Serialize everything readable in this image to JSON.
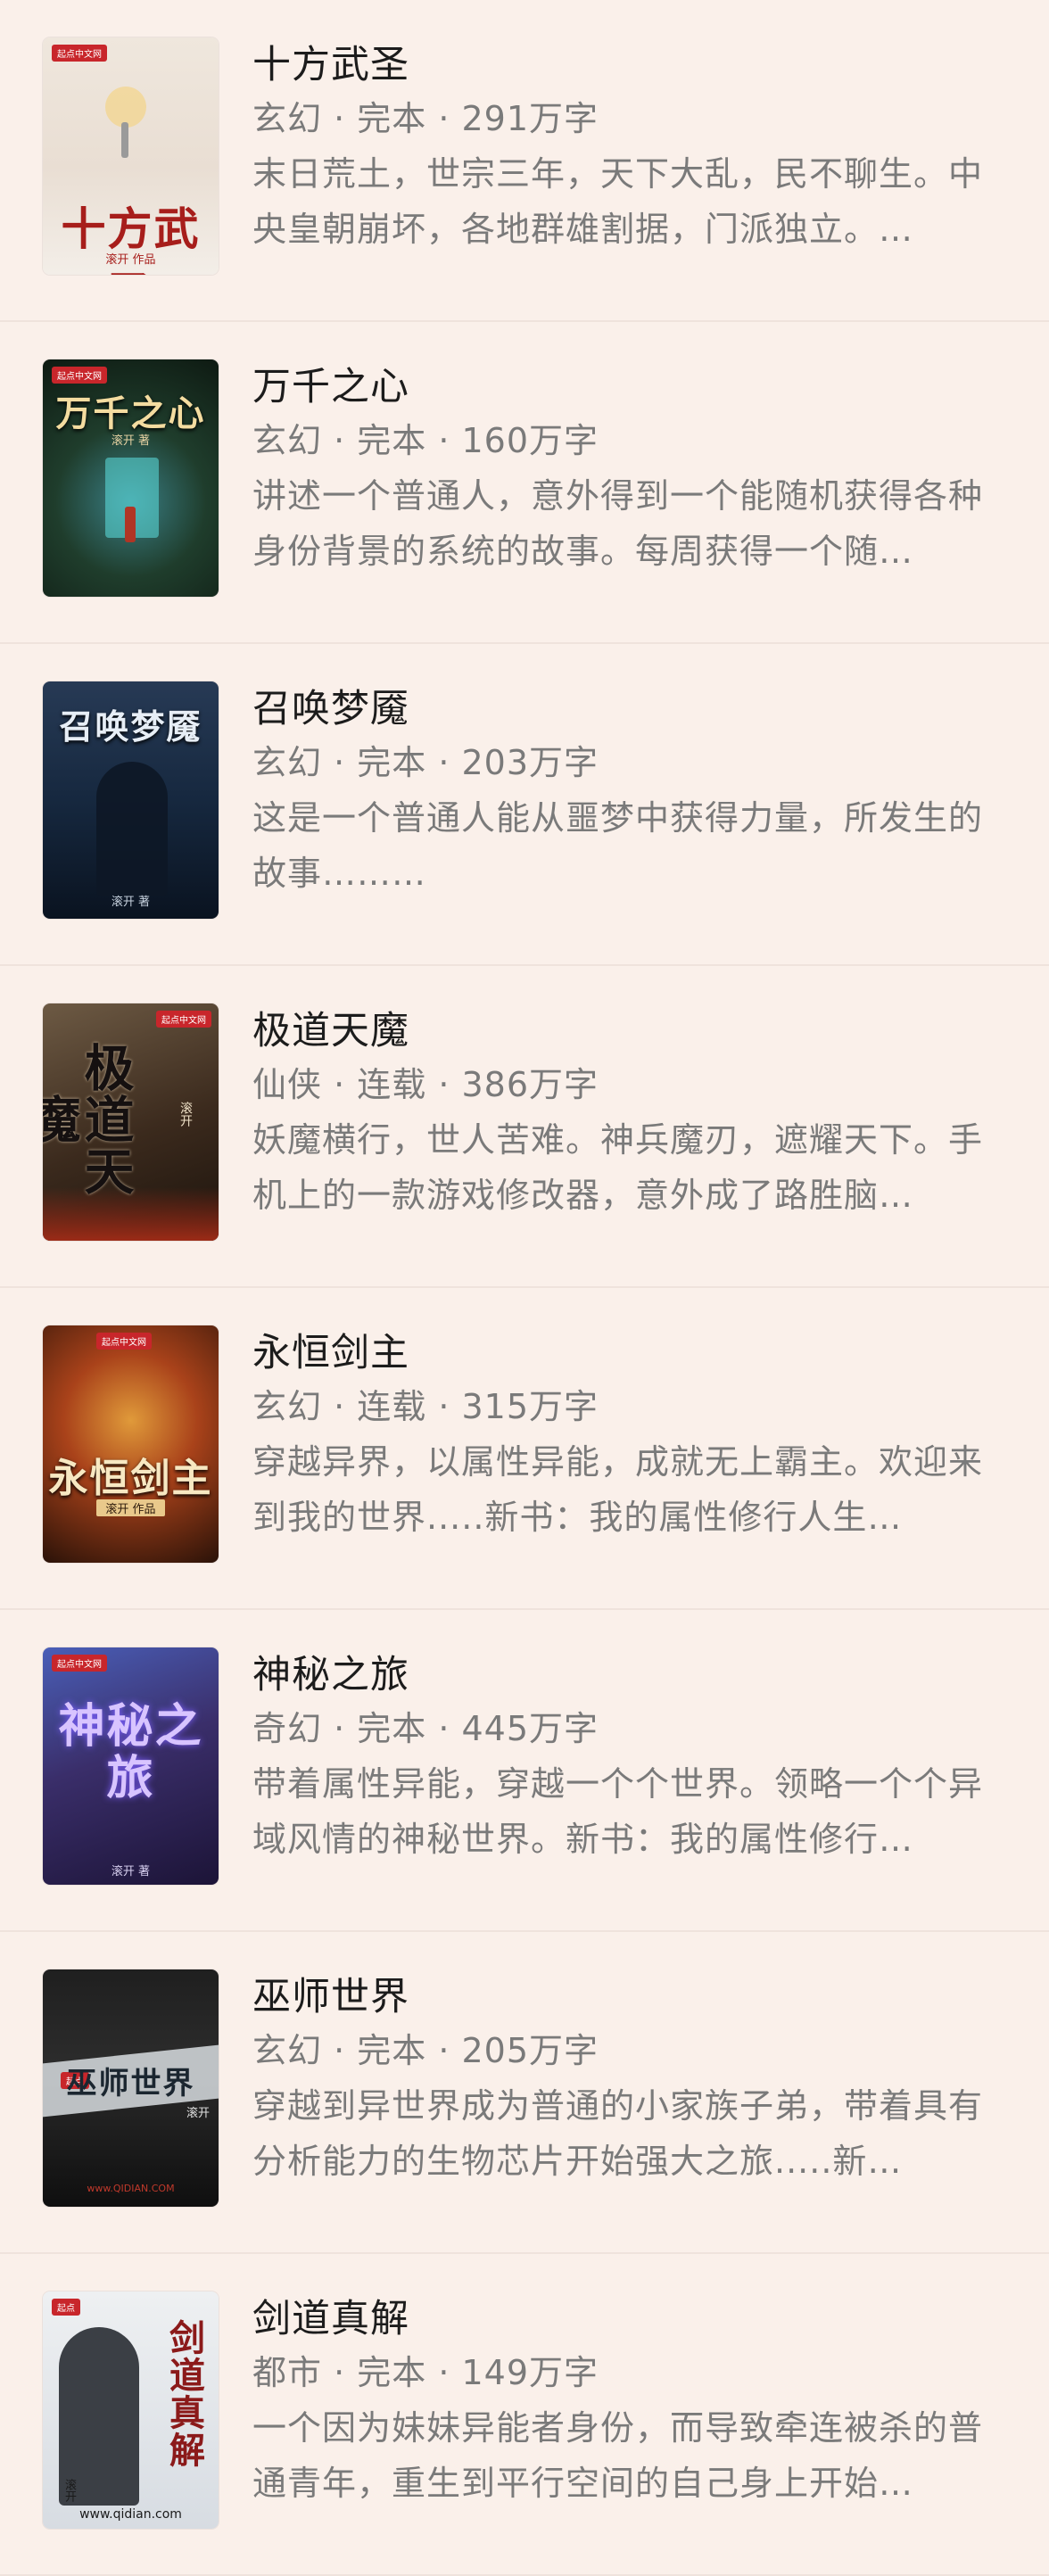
{
  "books": [
    {
      "title": "十方武圣",
      "meta": "玄幻 · 完本 · 291万字",
      "desc": "末日荒土，世宗三年，天下大乱，民不聊生。中央皇朝崩坏，各地群雄割据，门派独立。…",
      "cover": {
        "title": "十方武圣",
        "author": "滚开 作品",
        "badge": "起点中文网"
      }
    },
    {
      "title": "万千之心",
      "meta": "玄幻 · 完本 · 160万字",
      "desc": "讲述一个普通人，意外得到一个能随机获得各种身份背景的系统的故事。每周获得一个随…",
      "cover": {
        "title": "万千之心",
        "author": "滚开 著",
        "badge": "起点中文网"
      }
    },
    {
      "title": "召唤梦魇",
      "meta": "玄幻 · 完本 · 203万字",
      "desc": "这是一个普通人能从噩梦中获得力量，所发生的故事………",
      "cover": {
        "title": "召唤梦魇",
        "author": "滚开 著",
        "badge": "起点中文网"
      }
    },
    {
      "title": "极道天魔",
      "meta": "仙侠 · 连载 · 386万字",
      "desc": "妖魔横行，世人苦难。神兵魔刃，遮耀天下。手机上的一款游戏修改器，意外成了路胜脑…",
      "cover": {
        "title": "极道天魔",
        "author": "滚开",
        "badge": "起点中文网"
      }
    },
    {
      "title": "永恒剑主",
      "meta": "玄幻 · 连载 · 315万字",
      "desc": "穿越异界，以属性异能，成就无上霸主。欢迎来到我的世界.....新书：我的属性修行人生…",
      "cover": {
        "title": "永恒剑主",
        "author": "滚开 作品",
        "badge": "起点中文网"
      }
    },
    {
      "title": "神秘之旅",
      "meta": "奇幻 · 完本 · 445万字",
      "desc": "带着属性异能，穿越一个个世界。领略一个个异域风情的神秘世界。新书：我的属性修行…",
      "cover": {
        "title": "神秘之旅",
        "author": "滚开 著",
        "badge": "起点中文网"
      }
    },
    {
      "title": "巫师世界",
      "meta": "玄幻 · 完本 · 205万字",
      "desc": "穿越到异世界成为普通的小家族子弟，带着具有分析能力的生物芯片开始强大之旅.....新…",
      "cover": {
        "title": "巫师世界",
        "author": "滚开",
        "badge": "起点",
        "site": "www.QIDIAN.COM"
      }
    },
    {
      "title": "剑道真解",
      "meta": "都市 · 完本 · 149万字",
      "desc": "一个因为妹妹异能者身份，而导致牵连被杀的普通青年，重生到平行空间的自己身上开始…",
      "cover": {
        "title": "剑道真解",
        "author": "滚开",
        "badge": "起点",
        "site": "www.qidian.com"
      }
    }
  ]
}
